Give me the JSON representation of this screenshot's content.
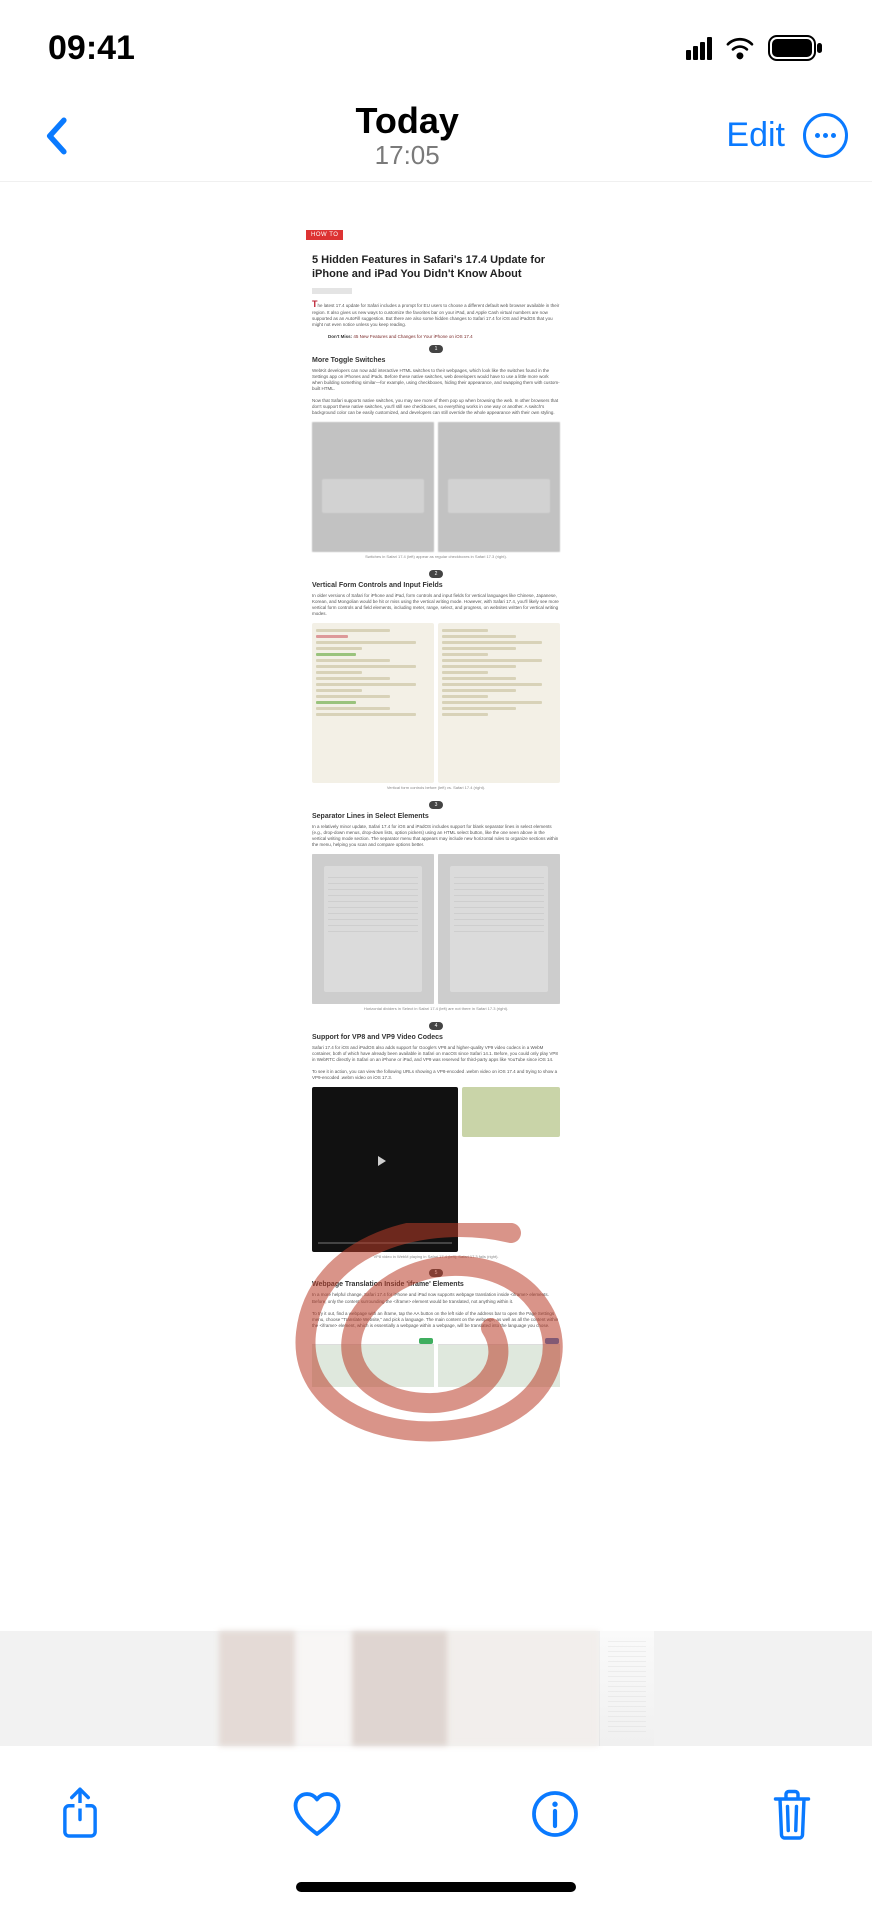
{
  "status": {
    "time": "09:41"
  },
  "nav": {
    "title": "Today",
    "subtitle": "17:05",
    "edit_label": "Edit"
  },
  "article": {
    "tag": "HOW TO",
    "title": "5 Hidden Features in Safari's 17.4 Update for iPhone and iPad You Didn't Know About",
    "intro": "The latest 17.4 update for Safari includes a prompt for EU users to choose a different default web browser available in their region. It also gives us new ways to customize the favorites bar on your iPad, and Apple Cash virtual numbers are now supported as an AutoFill suggestion. But there are also some hidden changes to Safari 17.4 for iOS and iPadOS that you might not even notice unless you keep reading.",
    "dont_miss_label": "Don't Miss:",
    "dont_miss_link": "45 New Features and Changes for Your iPhone on iOS 17.4",
    "sec1": {
      "num": "1",
      "title": "More Toggle Switches",
      "p1": "WebKit developers can now add interactive HTML switches to their webpages, which look like the switches found in the Settings app on iPhones and iPads. Before these native switches, web developers would have to use a little more work when building something similar—for example, using checkboxes, hiding their appearance, and swapping them with custom-built HTML.",
      "p2": "Now that Safari supports native switches, you may see more of them pop up when browsing the web. In other browsers that don't support these native switches, you'll still see checkboxes, so everything works in one way or another. A switch's background color can be easily customized, and developers can still override the whole appearance with their own styling.",
      "cap": "Switches in Safari 17.4 (left) appear as regular checkboxes in Safari 17.3 (right)."
    },
    "sec2": {
      "num": "2",
      "title": "Vertical Form Controls and Input Fields",
      "p1": "In older versions of Safari for iPhone and iPad, form controls and input fields for vertical languages like Chinese, Japanese, Korean, and Mongolian would be hit or miss using the vertical writing mode. However, with Safari 17.4, you'll likely see more vertical form controls and field elements, including meter, range, select, and progress, on websites written for vertical writing modes.",
      "cap": "Vertical form controls before (left) vs. Safari 17.4 (right)."
    },
    "sec3": {
      "num": "3",
      "title": "Separator Lines in Select Elements",
      "p1": "In a relatively minor update, Safari 17.4 for iOS and iPadOS includes support for blank separator lines in select elements (e.g., drop-down menus, drop-down lists, option pickers) using an HTML select button, like the one seen above in the vertical writing mode section. The separator menu that appears may include new horizontal rules to organize sections within the menu, helping you scan and compare options better.",
      "cap": "Horizontal dividers in Select in Safari 17.4 (left) are not there in Safari 17.3 (right)."
    },
    "sec4": {
      "num": "4",
      "title": "Support for VP8 and VP9 Video Codecs",
      "p1": "Safari 17.4 for iOS and iPadOS also adds support for Google's VP8 and higher-quality VP9 video codecs in a WebM container, both of which have already been available in Safari on macOS since Safari 14.1. Before, you could only play VP8 in WebRTC directly in Safari on an iPhone or iPad, and VP9 was reserved for third-party apps like YouTube since iOS 14.",
      "p2": "To see it in action, you can view the following URLs showing a VP8-encoded .webm video on iOS 17.4 and trying to show a VP9-encoded .webm video on iOS 17.3.",
      "cap": "VP8 video in WebM playing in Safari 17.4 (left); Safari 17.3 fails (right)."
    },
    "sec5": {
      "num": "5",
      "title": "Webpage Translation Inside 'iframe' Elements",
      "p1": "In a more helpful change, Safari 17.4 for iPhone and iPad now supports webpage translation inside <iframe> elements. Before, only the content surrounding the <iframe> element would be translated, not anything within it.",
      "p2": "To try it out, find a webpage with an iframe, tap the AA button on the left side of the address bar to open the Page Settings menu, choose \"Translate Website,\" and pick a language. The main content on the webpage, as well as all the content within the <iframe> element, which is essentially a webpage within a webpage, will be translated into the language you chose."
    }
  },
  "toolbar": {
    "share": "share-icon",
    "like": "heart-icon",
    "info": "info-icon",
    "delete": "trash-icon"
  }
}
